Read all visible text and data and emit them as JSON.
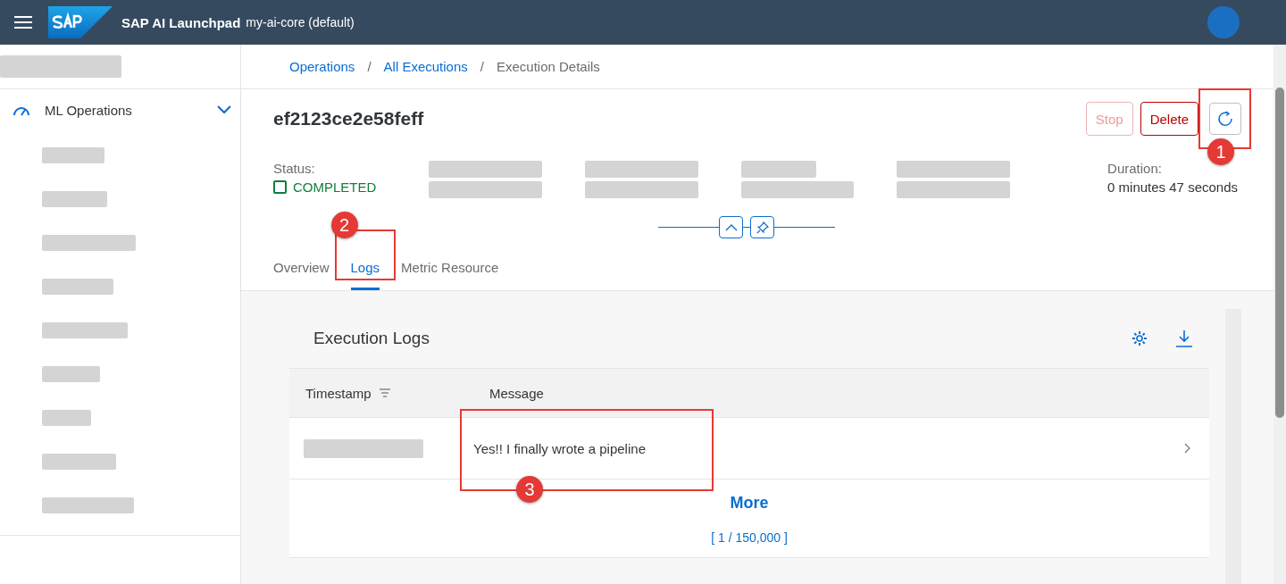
{
  "shell_bar": {
    "product": "SAP AI Launchpad",
    "context": "my-ai-core (default)"
  },
  "sidebar": {
    "top": {
      "kind": "redacted"
    },
    "group": {
      "label": "ML Operations",
      "expanded": true,
      "children": [
        {
          "kind": "redacted"
        },
        {
          "kind": "redacted"
        },
        {
          "kind": "redacted"
        },
        {
          "kind": "redacted"
        },
        {
          "kind": "redacted"
        },
        {
          "kind": "redacted"
        },
        {
          "kind": "redacted"
        },
        {
          "kind": "redacted"
        },
        {
          "kind": "redacted"
        }
      ]
    }
  },
  "breadcrumbs": [
    {
      "label": "Operations",
      "kind": "link"
    },
    {
      "label": "/",
      "kind": "separator"
    },
    {
      "label": "All Executions",
      "kind": "link"
    },
    {
      "label": "/",
      "kind": "separator"
    },
    {
      "label": "Execution Details",
      "kind": "current"
    }
  ],
  "header": {
    "title": "ef2123ce2e58feff",
    "buttons": [
      {
        "label": "Stop",
        "disabled": true
      },
      {
        "label": "Delete",
        "disabled": false
      }
    ],
    "fields": [
      {
        "kind": "status",
        "label": "Status:",
        "value": "COMPLETED"
      },
      {
        "kind": "redacted"
      },
      {
        "kind": "redacted"
      },
      {
        "kind": "redacted"
      },
      {
        "kind": "redacted"
      },
      {
        "kind": "text",
        "label": "Duration:",
        "value": "0 minutes 47 seconds"
      }
    ]
  },
  "tabs": [
    {
      "label": "Overview",
      "selected": false
    },
    {
      "label": "Logs",
      "selected": true
    },
    {
      "label": "Metric Resource",
      "selected": false
    }
  ],
  "logs": {
    "title": "Execution Logs",
    "columns": [
      {
        "label": "Timestamp",
        "sortable": true
      },
      {
        "label": "Message",
        "sortable": false
      }
    ],
    "rows": [
      {
        "timestamp": {
          "kind": "redacted"
        },
        "message": "Yes!! I finally wrote a pipeline"
      }
    ],
    "more": "More",
    "count": "[ 1 / 150,000 ]"
  },
  "annotations": [
    {
      "number": "1"
    },
    {
      "number": "2"
    },
    {
      "number": "3"
    }
  ]
}
